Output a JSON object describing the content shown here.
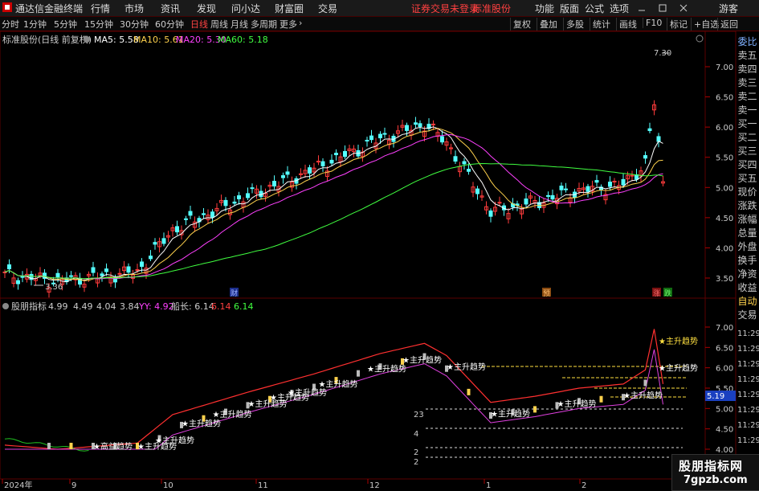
{
  "window": {
    "app_title": "通达信金融终端",
    "menu": [
      "行情",
      "市场",
      "资讯",
      "发现",
      "问小达",
      "财富圈",
      "交易"
    ],
    "warning": "证券交易未登录",
    "stock_name": "标准股份",
    "right_menu": [
      "功能",
      "版面",
      "公式",
      "选项"
    ],
    "user": "游客"
  },
  "periods": [
    "分时",
    "1分钟",
    "5分钟",
    "15分钟",
    "30分钟",
    "60分钟",
    "日线",
    "周线",
    "月线",
    "多周期",
    "更多"
  ],
  "active_period": "日线",
  "toolbar_right": [
    "复权",
    "叠加",
    "多股",
    "统计",
    "画线",
    "F10",
    "标记",
    "+自选",
    "返回"
  ],
  "main_chart": {
    "header_title": "标准股份(日线 前复权)",
    "ma": [
      {
        "label": "MA5: 5.58",
        "color": "#ffffff"
      },
      {
        "label": "MA10: 5.61",
        "color": "#ffd24d"
      },
      {
        "label": "MA20: 5.30",
        "color": "#ff40ff"
      },
      {
        "label": "MA60: 5.18",
        "color": "#40ff40"
      }
    ],
    "y_ticks": [
      "7.00",
      "6.50",
      "6.00",
      "5.50",
      "5.00",
      "4.50",
      "4.00",
      "3.50"
    ],
    "high_label": "7.30",
    "low_label": "3.36",
    "event_markers": [
      {
        "text": "财",
        "color": "#3060ff"
      },
      {
        "text": "预",
        "color": "#ff9030"
      },
      {
        "text": "涨",
        "color": "#ff3030"
      },
      {
        "text": "跌",
        "color": "#30ff30"
      }
    ]
  },
  "indicator": {
    "name": "股朋指标",
    "values": [
      "4.99",
      "4.49",
      "4.04",
      "3.84"
    ],
    "yy_label": "YY: 4.92",
    "ship_label": "船长: 6.14",
    "red_value": "6.14",
    "green_value": "6.14",
    "y_ticks": [
      "7.00",
      "6.50",
      "6.00",
      "5.50",
      "5.00",
      "4.50",
      "4.00"
    ],
    "current_price_tag": "5.19",
    "signal_text": "主升趋势",
    "other_signal": "高益趋势",
    "count_labels": [
      "23",
      "4",
      "2",
      "2"
    ]
  },
  "x_axis": [
    "2024年",
    "9",
    "10",
    "11",
    "12",
    "1",
    "2"
  ],
  "right_panel": [
    {
      "text": "委比",
      "color": "blue"
    },
    {
      "text": "卖五",
      "color": "normal"
    },
    {
      "text": "卖四",
      "color": "normal"
    },
    {
      "text": "卖三",
      "color": "normal"
    },
    {
      "text": "卖二",
      "color": "normal"
    },
    {
      "text": "卖一",
      "color": "normal"
    },
    {
      "text": "买一",
      "color": "normal"
    },
    {
      "text": "买二",
      "color": "normal"
    },
    {
      "text": "买三",
      "color": "normal"
    },
    {
      "text": "买四",
      "color": "normal"
    },
    {
      "text": "买五",
      "color": "normal"
    },
    {
      "text": "现价",
      "color": "normal"
    },
    {
      "text": "涨跌",
      "color": "normal"
    },
    {
      "text": "涨幅",
      "color": "normal"
    },
    {
      "text": "总量",
      "color": "normal"
    },
    {
      "text": "外盘",
      "color": "normal"
    },
    {
      "text": "换手",
      "color": "normal"
    },
    {
      "text": "净资",
      "color": "normal"
    },
    {
      "text": "收益",
      "color": "normal"
    },
    {
      "text": "自动",
      "color": "yellow"
    },
    {
      "text": "交易",
      "color": "normal"
    }
  ],
  "time_labels": [
    "11:29",
    "11:29",
    "11:29",
    "11:29",
    "11:29",
    "11:29",
    "11:29",
    "11:29"
  ],
  "watermark": {
    "line1": "股朋指标网",
    "line2": "7gpzb.com"
  }
}
